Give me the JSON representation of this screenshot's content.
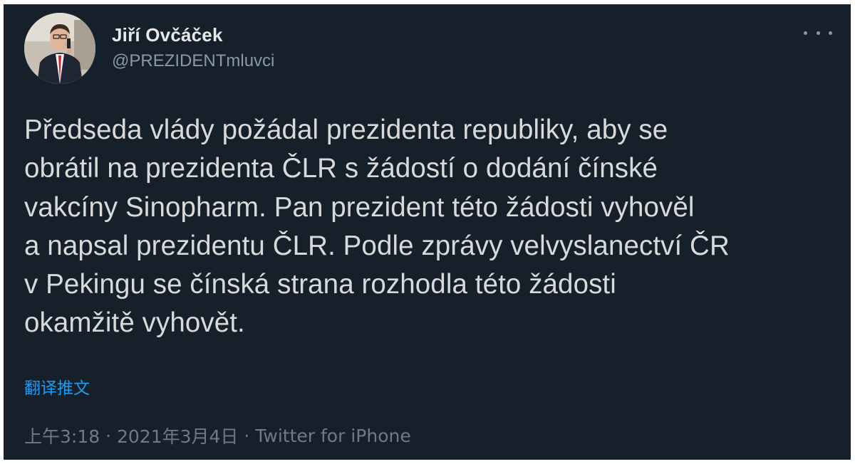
{
  "tweet": {
    "author": {
      "name": "Jiří Ovčáček",
      "handle": "@PREZIDENTmluvci"
    },
    "text": "Předseda vlády požádal prezidenta republiky, aby se\nobrátil na prezidenta ČLR s žádostí o dodání čínské\nvakcíny Sinopharm. Pan prezident této žádosti vyhověl\na napsal prezidentu ČLR. Podle zprávy velvyslanectví ČR\nv Pekingu se čínská strana rozhodla této žádosti\nokamžitě vyhovět.",
    "translate_label": "翻译推文",
    "time": "上午3:18",
    "separator": " · ",
    "date": "2021年3月4日",
    "source": "Twitter for iPhone"
  },
  "icons": {
    "avatar": "profile-photo",
    "more": "more-dots-icon"
  },
  "colors": {
    "background": "#15202b",
    "text": "#d9d9d9",
    "secondary": "#8b98a5",
    "link": "#1d9bf0"
  }
}
